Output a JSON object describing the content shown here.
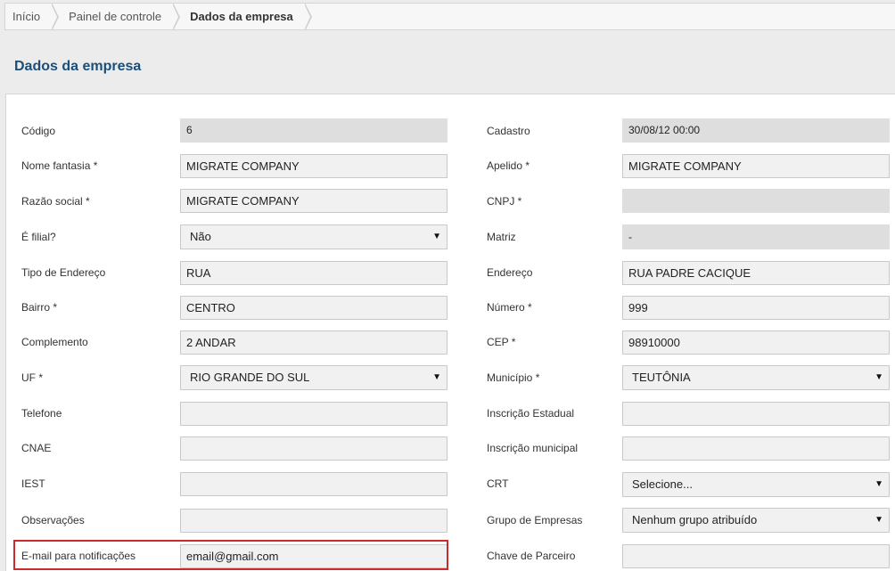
{
  "breadcrumb": {
    "items": [
      "Início",
      "Painel de controle",
      "Dados da empresa"
    ]
  },
  "page": {
    "title": "Dados da empresa"
  },
  "form": {
    "codigo": {
      "label": "Código",
      "value": "6"
    },
    "cadastro": {
      "label": "Cadastro",
      "value": "30/08/12 00:00"
    },
    "nome_fantasia": {
      "label": "Nome fantasia *",
      "value": "MIGRATE COMPANY"
    },
    "apelido": {
      "label": "Apelido *",
      "value": "MIGRATE COMPANY"
    },
    "razao_social": {
      "label": "Razão social *",
      "value": "MIGRATE COMPANY"
    },
    "cnpj": {
      "label": "CNPJ *",
      "value": ""
    },
    "e_filial": {
      "label": "É filial?",
      "value": "Não"
    },
    "matriz": {
      "label": "Matriz",
      "value": "-"
    },
    "tipo_endereco": {
      "label": "Tipo de Endereço",
      "value": "RUA"
    },
    "endereco": {
      "label": "Endereço",
      "value": "RUA PADRE CACIQUE"
    },
    "bairro": {
      "label": "Bairro *",
      "value": "CENTRO"
    },
    "numero": {
      "label": "Número *",
      "value": "999"
    },
    "complemento": {
      "label": "Complemento",
      "value": "2 ANDAR"
    },
    "cep": {
      "label": "CEP *",
      "value": "98910000"
    },
    "uf": {
      "label": "UF *",
      "value": "RIO GRANDE DO SUL"
    },
    "municipio": {
      "label": "Município *",
      "value": "TEUTÔNIA"
    },
    "telefone": {
      "label": "Telefone",
      "value": ""
    },
    "inscricao_estadual": {
      "label": "Inscrição Estadual",
      "value": ""
    },
    "cnae": {
      "label": "CNAE",
      "value": ""
    },
    "inscricao_municipal": {
      "label": "Inscrição municipal",
      "value": ""
    },
    "iest": {
      "label": "IEST",
      "value": ""
    },
    "crt": {
      "label": "CRT",
      "value": "Selecione..."
    },
    "observacoes": {
      "label": "Observações",
      "value": ""
    },
    "grupo_empresas": {
      "label": "Grupo de Empresas",
      "value": "Nenhum grupo atribuído"
    },
    "email_notificacoes": {
      "label": "E-mail para notificações",
      "value": "email@gmail.com"
    },
    "chave_parceiro": {
      "label": "Chave de Parceiro",
      "value": ""
    }
  },
  "icons": {
    "select_arrow": "triangle-down-icon"
  },
  "colors": {
    "title": "#1c4e78",
    "highlight": "#cc2b2b",
    "readonly_bg": "#dedede",
    "input_bg": "#f1f1f1"
  }
}
